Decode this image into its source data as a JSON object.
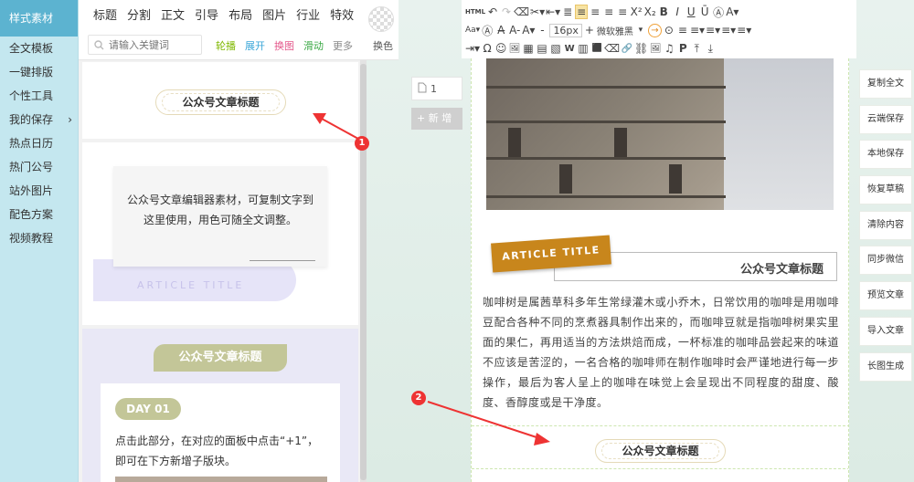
{
  "left_nav": {
    "items": [
      {
        "label": "样式素材",
        "chevron": ""
      },
      {
        "label": "全文模板",
        "chevron": ""
      },
      {
        "label": "一键排版",
        "chevron": ""
      },
      {
        "label": "个性工具",
        "chevron": ""
      },
      {
        "label": "我的保存",
        "chevron": "›"
      },
      {
        "label": "热点日历",
        "chevron": ""
      },
      {
        "label": "热门公号",
        "chevron": ""
      },
      {
        "label": "站外图片",
        "chevron": ""
      },
      {
        "label": "配色方案",
        "chevron": ""
      },
      {
        "label": "视频教程",
        "chevron": ""
      }
    ],
    "active_index": 0
  },
  "materials": {
    "categories": [
      "标题",
      "分割",
      "正文",
      "引导",
      "布局",
      "图片",
      "行业",
      "特效"
    ],
    "search_placeholder": "请输入关键词",
    "subtabs": [
      {
        "label": "轮播",
        "color": "#7fb800"
      },
      {
        "label": "展开",
        "color": "#3aa6d8"
      },
      {
        "label": "换图",
        "color": "#e4588b"
      },
      {
        "label": "滑动",
        "color": "#3aa844"
      },
      {
        "label": "更多",
        "color": "#888888"
      }
    ],
    "swap_label": "换色",
    "card1_title": "公众号文章标题",
    "card2_text": "公众号文章编辑器素材，可复制文字到这里使用，用色可随全文调整。",
    "card2_article_title": "ARTICLE TITLE",
    "card3_title": "公众号文章标题",
    "card3_day": "DAY 01",
    "card3_text": "点击此部分，在对应的面板中点击“+1”，即可在下方新增子版块。"
  },
  "toolbar": {
    "row1": [
      "HTML",
      "↶",
      "↷",
      "⌫",
      "✂▾",
      "⇤▾",
      "≣",
      "≡",
      "≡",
      "≡",
      "≡",
      "X²",
      "X₂",
      "B",
      "I",
      "U",
      "Ū",
      "Ⓐ",
      "A▾"
    ],
    "row2": [
      "Aa▾",
      "Ⓐ",
      "A̶",
      "A-",
      "A▾",
      "-",
      "16px",
      "+",
      "微软雅黑",
      "▾",
      "→",
      "⊙",
      "≡",
      "≡▾",
      "≡▾",
      "≡▾",
      "≡▾"
    ],
    "row3": [
      "⇥▾",
      "Ω",
      "☺",
      "🖼",
      "▦",
      "▤",
      "▧",
      "W",
      "▥",
      "⬛",
      "⌫",
      "🔗",
      "⛓",
      "🖼",
      "♫",
      "P",
      "⤒",
      "⤓"
    ],
    "font_size": "16px",
    "font_family": "微软雅黑"
  },
  "editor": {
    "article_tag": "ARTICLE TITLE",
    "heading": "公众号文章标题",
    "body": "咖啡树是属茜草科多年生常绿灌木或小乔木，日常饮用的咖啡是用咖啡豆配合各种不同的烹煮器具制作出来的，而咖啡豆就是指咖啡树果实里面的果仁，再用适当的方法烘焙而成，一杯标准的咖啡品尝起来的味道不应该是苦涩的，一名合格的咖啡师在制作咖啡时会严谨地进行每一步操作，最后为客人呈上的咖啡在味觉上会呈现出不同程度的甜度、酸度、香醇度或是干净度。",
    "section2_title": "公众号文章标题"
  },
  "pages": {
    "current_page": "1",
    "add_label": "+ 新 增"
  },
  "right_bar": {
    "buttons": [
      "复制全文",
      "云端保存",
      "本地保存",
      "恢复草稿",
      "清除内容",
      "同步微信",
      "预览文章",
      "导入文章",
      "长图生成"
    ]
  },
  "annotations": {
    "marker1": "1",
    "marker2": "2"
  },
  "colors": {
    "nav_active": "#5cb3d0",
    "nav_bg": "#c4e7ef",
    "accent_orange": "#c8861c",
    "olive_green": "#c3c698",
    "marker_red": "#e33333"
  }
}
